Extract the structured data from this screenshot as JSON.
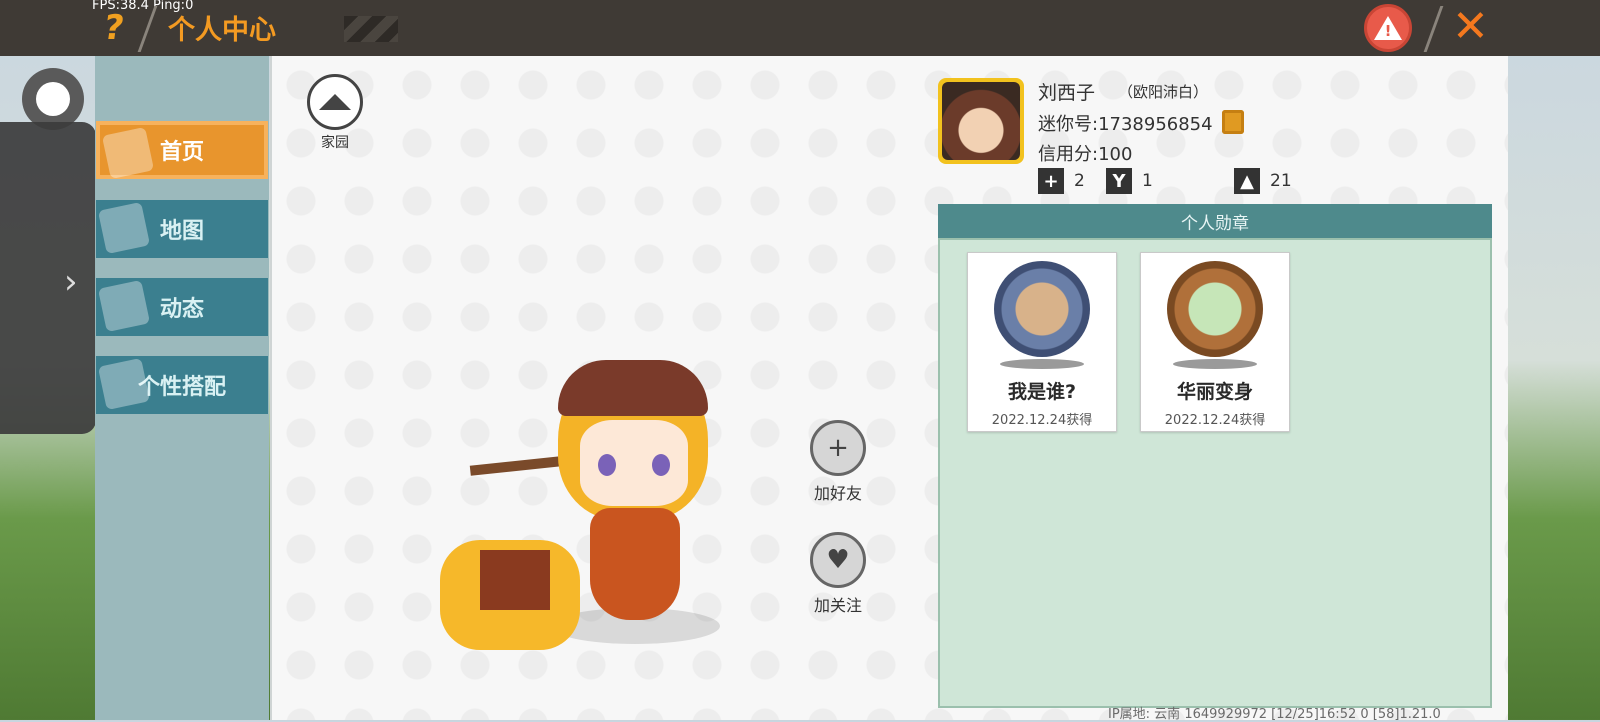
{
  "header": {
    "fps_text": "FPS:38.4  Ping:0",
    "title": "个人中心",
    "help_glyph": "?",
    "close_glyph": "✕",
    "alert_glyph": "!"
  },
  "sidebar": {
    "expand_glyph": "›",
    "items": [
      {
        "label": "首页",
        "active": true
      },
      {
        "label": "地图",
        "active": false
      },
      {
        "label": "动态",
        "active": false
      },
      {
        "label": "个性搭配",
        "active": false
      }
    ]
  },
  "home": {
    "label": "家园"
  },
  "actions": {
    "add_friend": "加好友",
    "follow": "加关注"
  },
  "profile": {
    "nickname": "刘西子",
    "real_name": "（欧阳沛白）",
    "mini_id": "迷你号:1738956854",
    "credit": "信用分:100",
    "stats": [
      {
        "icon": "add-icon",
        "value": "2"
      },
      {
        "icon": "fans-icon",
        "value": "1"
      },
      {
        "icon": "fire-icon",
        "value": "21"
      }
    ]
  },
  "badges": {
    "header": "个人勋章",
    "items": [
      {
        "name": "我是谁?",
        "date": "2022.12.24获得",
        "color": "#6a7fa8"
      },
      {
        "name": "华丽变身",
        "date": "2022.12.24获得",
        "color": "#b0703a"
      }
    ]
  },
  "footer": {
    "text": "IP属地: 云南     1649929972     [12/25]16:52 0   [58]1.21.0"
  },
  "colors": {
    "accent": "#f39a22",
    "nav_active": "#e8952d",
    "nav_default": "#3b7f8f",
    "badge_header": "#4e8a8c"
  }
}
